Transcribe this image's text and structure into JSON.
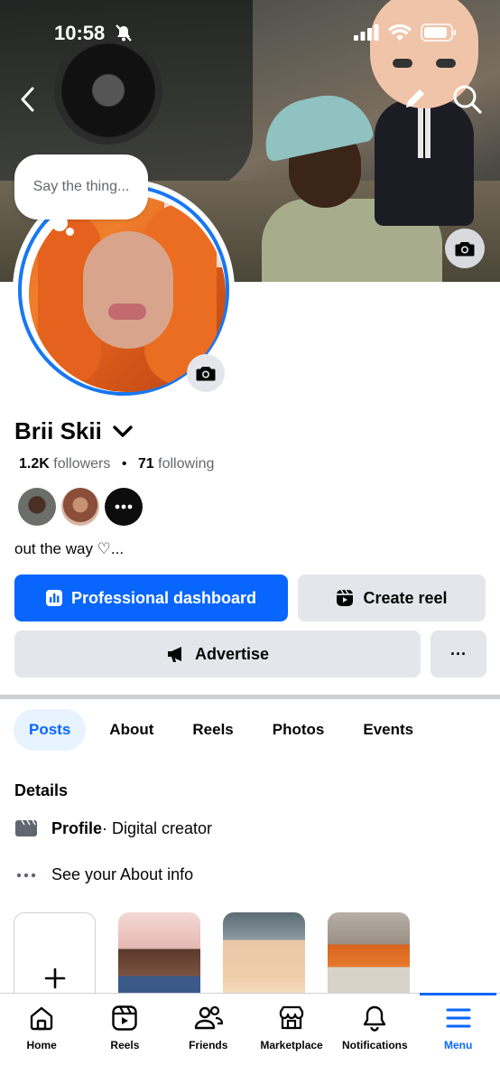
{
  "status_bar": {
    "time": "10:58"
  },
  "profile": {
    "note_placeholder": "Say the thing...",
    "name": "Brii Skii",
    "followers_count": "1.2K",
    "followers_label": "followers",
    "following_count": "71",
    "following_label": "following",
    "bio": "out the way ♡..."
  },
  "actions": {
    "professional_dashboard": "Professional dashboard",
    "create_reel": "Create reel",
    "advertise": "Advertise",
    "more": "···"
  },
  "tabs": [
    "Posts",
    "About",
    "Reels",
    "Photos",
    "Events"
  ],
  "details": {
    "heading": "Details",
    "profile_label": "Profile",
    "profile_category": " · Digital creator",
    "about_link": "See your About info"
  },
  "bottom_nav": [
    "Home",
    "Reels",
    "Friends",
    "Marketplace",
    "Notifications",
    "Menu"
  ],
  "colors": {
    "accent": "#0866ff",
    "gray_button": "#e4e6eb",
    "secondary_text": "#65676b"
  }
}
